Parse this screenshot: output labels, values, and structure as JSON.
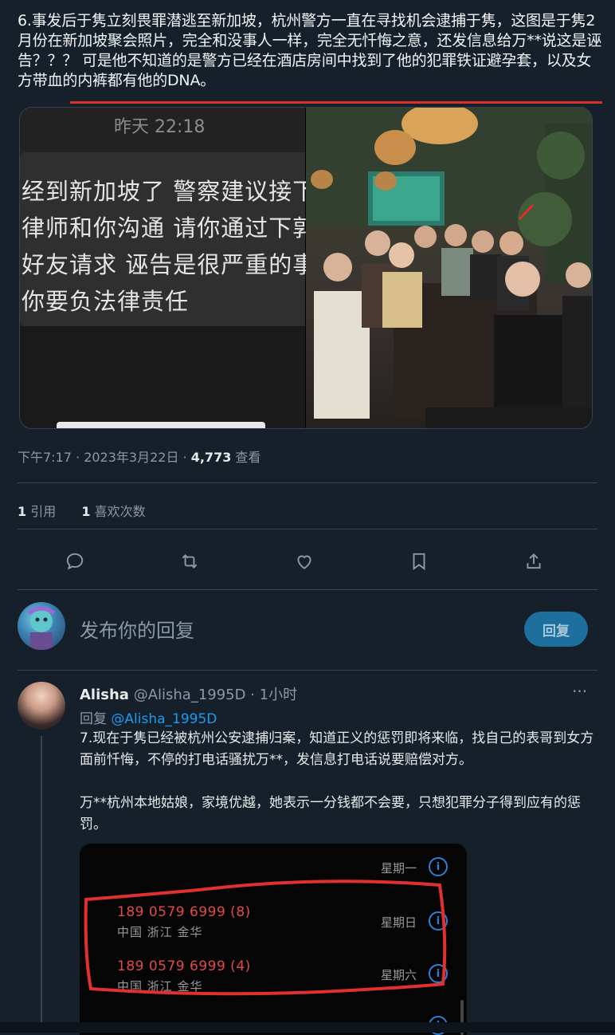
{
  "tweet": {
    "text": "6.事发后于隽立刻畏罪潜逃至新加坡，杭州警方一直在寻找机会逮捕于隽，这图是于隽2月份在新加坡聚会照片，完全和没事人一样，完全无忏悔之意，还发信息给万**说这是诬告？？？ 可是他不知道的是警方已经在酒店房间中找到了他的犯罪铁证避孕套，以及女方带血的内裤都有他的DNA。",
    "chat": {
      "time": "昨天 22:18",
      "lines": [
        "经到新加坡了 警察建议接下",
        "律师和你沟通 请你通过下郭",
        "好友请求 诬告是很严重的事",
        "你要负法律责任"
      ]
    },
    "meta": {
      "time_date": "下午7:17 · 2023年3月22日 · ",
      "views_count": "4,773",
      "views_label": " 查看"
    },
    "stats": {
      "quotes_count": "1",
      "quotes_label": " 引用",
      "likes_count": "1",
      "likes_label": " 喜欢次数"
    }
  },
  "actions": {
    "icons": [
      "reply-icon",
      "retweet-icon",
      "like-icon",
      "bookmark-icon",
      "share-icon"
    ]
  },
  "compose": {
    "placeholder": "发布你的回复",
    "button": "回复"
  },
  "reply": {
    "name": "Alisha",
    "handle": "@Alisha_1995D",
    "time": " · 1小时",
    "more": "···",
    "replying_to_label": "回复 ",
    "replying_to_handle": "@Alisha_1995D",
    "paragraph1": "7.现在于隽已经被杭州公安逮捕归案，知道正义的惩罚即将来临，找自己的表哥到女方面前忏悔，不停的打电话骚扰万**，发信息打电话说要赔偿对方。",
    "paragraph2": "万**杭州本地姑娘，家境优越，她表示一分钱都不会要，只想犯罪分子得到应有的惩罚。",
    "call_log": {
      "rows": [
        {
          "day": "星期一",
          "number": "",
          "location": ""
        },
        {
          "day": "星期日",
          "number": "189 0579 6999 (8)",
          "location": "中国 浙江 金华"
        },
        {
          "day": "星期六",
          "number": "189 0579 6999 (4)",
          "location": "中国 浙江 金华"
        }
      ]
    }
  },
  "colors": {
    "background": "#15202b",
    "accent": "#1d9bf0",
    "highlight_red": "#d8302a"
  }
}
